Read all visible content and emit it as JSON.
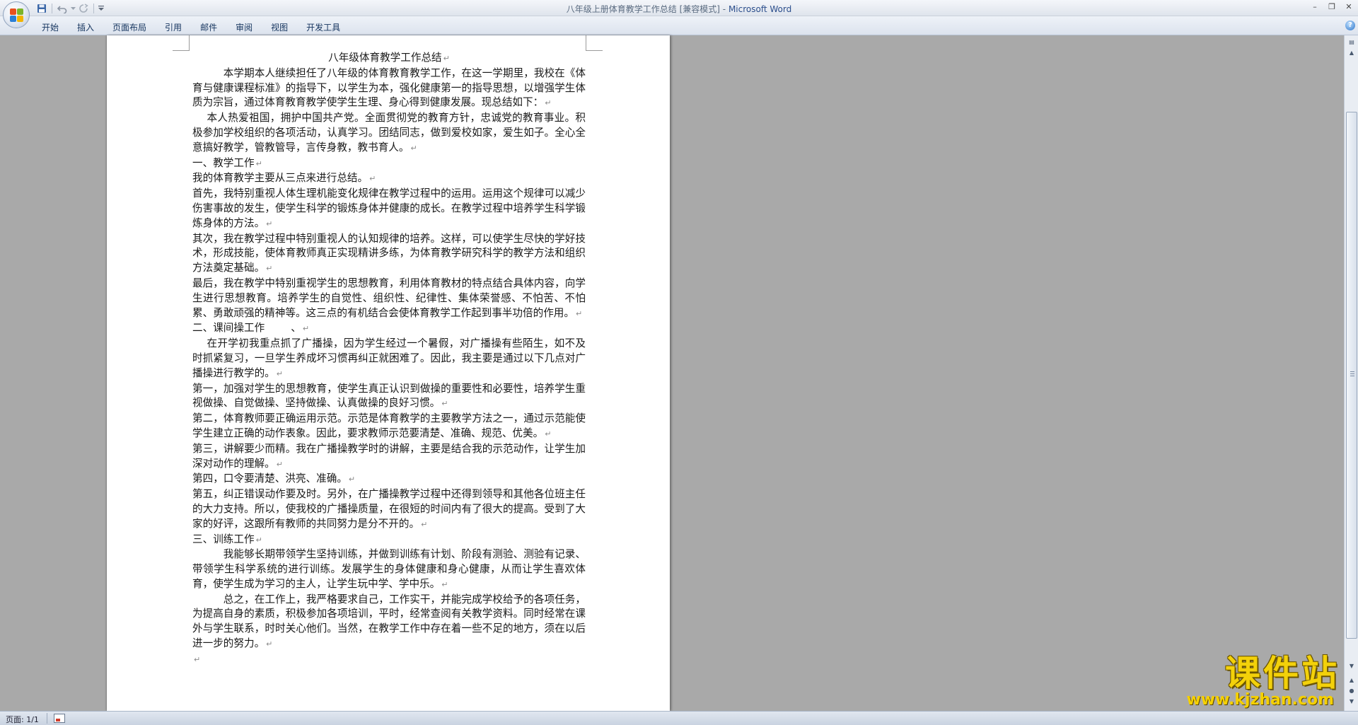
{
  "window": {
    "doc_title": "八年级上册体育教学工作总结 [兼容模式]",
    "separator": " - ",
    "app_name": "Microsoft Word"
  },
  "colors": {
    "accent": "#2b4e8c",
    "watermark": "#f3d10a",
    "workspace": "#a9a9a9"
  },
  "quick_access": {
    "icons": [
      "save-icon",
      "undo-icon",
      "redo-icon",
      "customize-icon"
    ]
  },
  "ribbon": {
    "tabs": [
      "开始",
      "插入",
      "页面布局",
      "引用",
      "邮件",
      "审阅",
      "视图",
      "开发工具"
    ]
  },
  "document": {
    "title": "八年级体育教学工作总结",
    "paragraphs": [
      "本学期本人继续担任了八年级的体育教育教学工作，在这一学期里，我校在《体育与健康课程标准》的指导下，以学生为本，强化健康第一的指导思想，以增强学生体质为宗旨，通过体育教育教学使学生生理、身心得到健康发展。现总结如下：",
      "本人热爱祖国，拥护中国共产党。全面贯彻党的教育方针，忠诚党的教育事业。积极参加学校组织的各项活动，认真学习。团结同志，做到爱校如家，爱生如子。全心全意搞好教学，管教管导，言传身教，教书育人。",
      "一、教学工作",
      "我的体育教学主要从三点来进行总结。",
      "首先，我特别重视人体生理机能变化规律在教学过程中的运用。运用这个规律可以减少伤害事故的发生，使学生科学的锻炼身体并健康的成长。在教学过程中培养学生科学锻炼身体的方法。",
      "其次，我在教学过程中特别重视人的认知规律的培养。这样，可以使学生尽快的学好技术，形成技能，使体育教师真正实现精讲多练，为体育教学研究科学的教学方法和组织方法奠定基础。",
      "最后，我在教学中特别重视学生的思想教育，利用体育教材的特点结合具体内容，向学生进行思想教育。培养学生的自觉性、组织性、纪律性、集体荣誉感、不怕苦、不怕累、勇敢顽强的精神等。这三点的有机结合会使体育教学工作起到事半功倍的作用。",
      "二、课间操工作        、",
      "在开学初我重点抓了广播操，因为学生经过一个暑假，对广播操有些陌生，如不及时抓紧复习，一旦学生养成坏习惯再纠正就困难了。因此，我主要是通过以下几点对广播操进行教学的。",
      "第一，加强对学生的思想教育，使学生真正认识到做操的重要性和必要性，培养学生重视做操、自觉做操、坚持做操、认真做操的良好习惯。",
      "第二，体育教师要正确运用示范。示范是体育教学的主要教学方法之一，通过示范能使学生建立正确的动作表象。因此，要求教师示范要清楚、准确、规范、优美。",
      "第三，讲解要少而精。我在广播操教学时的讲解，主要是结合我的示范动作，让学生加深对动作的理解。",
      "第四，口令要清楚、洪亮、准确。",
      "第五，纠正错误动作要及时。另外，在广播操教学过程中还得到领导和其他各位班主任的大力支持。所以，使我校的广播操质量，在很短的时间内有了很大的提高。受到了大家的好评，这跟所有教师的共同努力是分不开的。",
      "三、训练工作",
      "我能够长期带领学生坚持训练，并做到训练有计划、阶段有测验、测验有记录、带领学生科学系统的进行训练。发展学生的身体健康和身心健康，从而让学生喜欢体育，使学生成为学习的主人，让学生玩中学、学中乐。",
      "总之，在工作上，我严格要求自己，工作实干，并能完成学校给予的各项任务，为提高自身的素质，积极参加各项培训，平时，经常查阅有关教学资料。同时经常在课外与学生联系，时时关心他们。当然，在教学工作中存在着一些不足的地方，须在以后进一步的努力。"
    ],
    "paragraph_mark": "↵"
  },
  "status": {
    "page": "页面: 1/1"
  },
  "watermark": {
    "title": "课件站",
    "url": "www.kjzhan.com"
  }
}
